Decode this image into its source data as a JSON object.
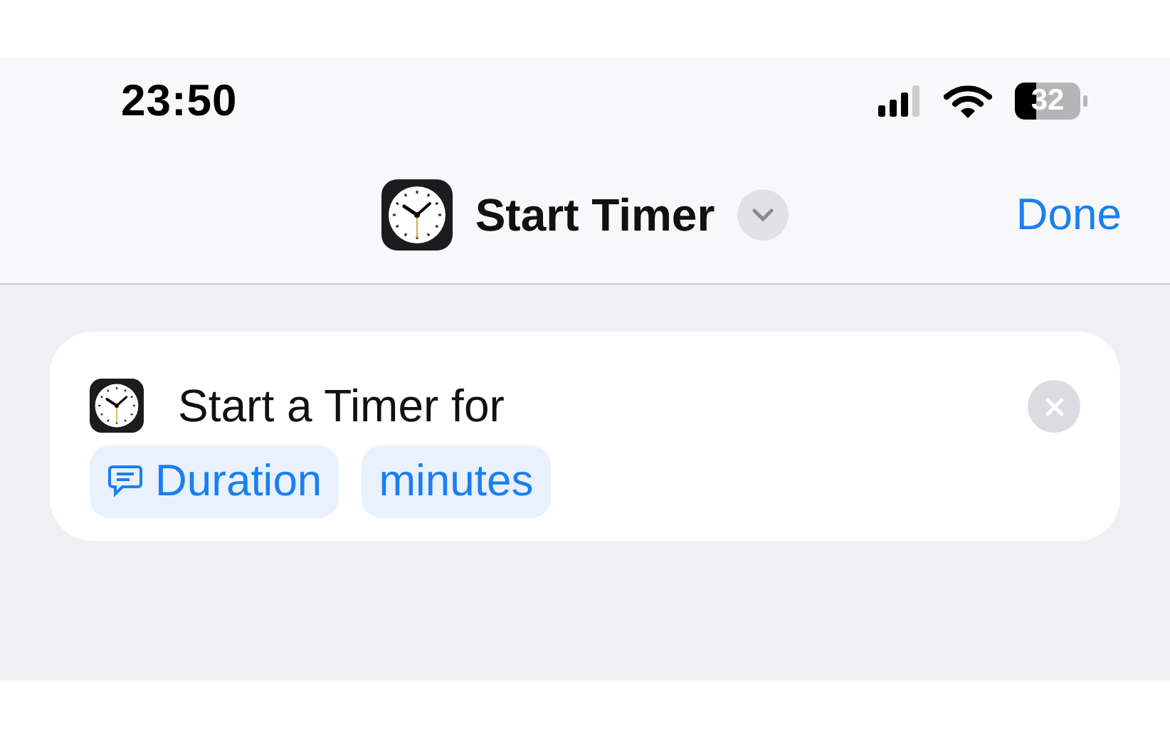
{
  "status_bar": {
    "time": "23:50",
    "battery": "32"
  },
  "nav_bar": {
    "title": "Start Timer",
    "done": "Done"
  },
  "action": {
    "text": "Start a Timer for",
    "tokens": [
      {
        "label": "Duration",
        "kind": "variable"
      },
      {
        "label": "minutes",
        "kind": "plain"
      }
    ]
  }
}
